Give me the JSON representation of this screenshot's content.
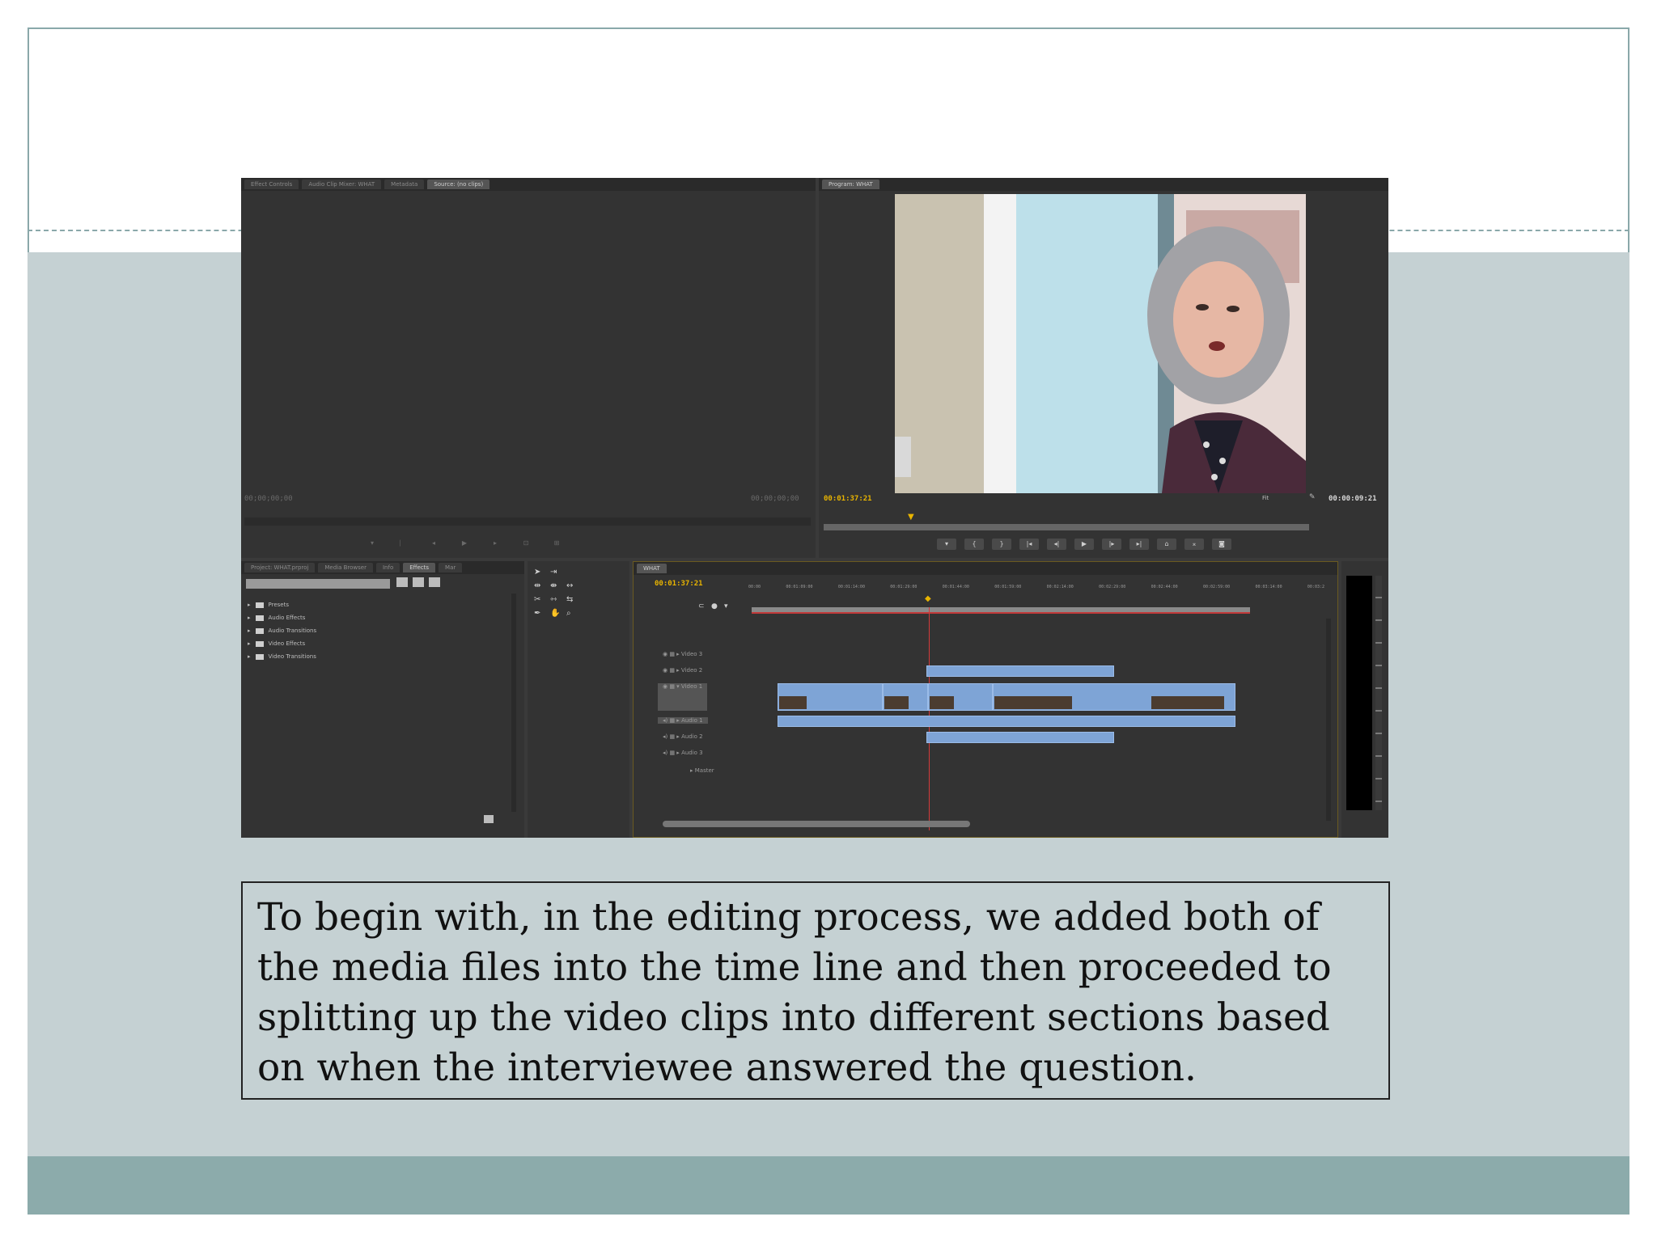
{
  "slide": {
    "caption": "To begin with, in the editing process, we added both of the media files into the time line and then proceeded to splitting up the video clips into different sections based on when the interviewee answered the question."
  },
  "editor": {
    "source_panel": {
      "tabs": [
        "Effect Controls",
        "Audio Clip Mixer: WHAT",
        "Metadata",
        "Source: (no clips)"
      ],
      "timecode_left": "00;00;00;00",
      "timecode_right": "00;00;00;00"
    },
    "program_panel": {
      "tab": "Program: WHAT",
      "timecode_current": "00:01:37:21",
      "fit_label": "Fit",
      "duration": "00:00:09:21"
    },
    "project_panel": {
      "tabs": [
        "Project: WHAT.prproj",
        "Media Browser",
        "Info",
        "Effects",
        "Mar"
      ],
      "items": [
        "Presets",
        "Audio Effects",
        "Audio Transitions",
        "Video Effects",
        "Video Transitions"
      ]
    },
    "timeline_panel": {
      "tab": "WHAT",
      "timecode": "00:01:37:21",
      "ruler_marks": [
        "00:00",
        "00:01:09:00",
        "00:01:14:00",
        "00:01:29:00",
        "00:01:44:00",
        "00:01:59:00",
        "00:02:14:00",
        "00:02:29:00",
        "00:02:44:00",
        "00:02:59:00",
        "00:03:14:00",
        "00:03:2"
      ],
      "tracks": [
        "Video 3",
        "Video 2",
        "Video 1",
        "Audio 1",
        "Audio 2",
        "Audio 3",
        "Master"
      ]
    },
    "colors": {
      "panel_bg": "#333333",
      "timecode_accent": "#e8b400",
      "clip_blue": "#7ea4d6",
      "playhead": "#d43b3b"
    }
  }
}
